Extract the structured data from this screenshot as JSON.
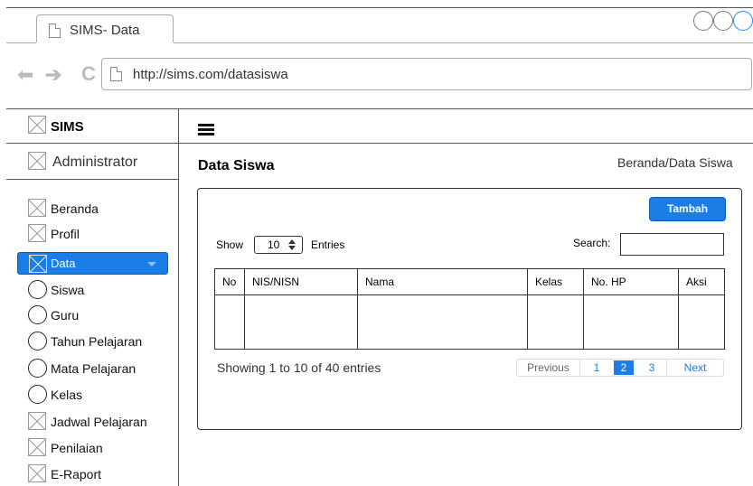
{
  "browser": {
    "tab_title": "SIMS- Data",
    "url": "http://sims.com/datasiswa",
    "back_glyph": "⬅",
    "forward_glyph": "➔",
    "reload_glyph": "C"
  },
  "sidebar": {
    "brand": "SIMS",
    "user": "Administrator",
    "items": [
      {
        "label": "Beranda",
        "icon": "image-placeholder-icon"
      },
      {
        "label": "Profil",
        "icon": "image-placeholder-icon"
      },
      {
        "label": "Data",
        "icon": "image-placeholder-icon",
        "active": true
      },
      {
        "label": "Siswa",
        "icon": "circle-icon"
      },
      {
        "label": "Guru",
        "icon": "circle-icon"
      },
      {
        "label": "Tahun Pelajaran",
        "icon": "circle-icon"
      },
      {
        "label": "Mata Pelajaran",
        "icon": "circle-icon"
      },
      {
        "label": "Kelas",
        "icon": "circle-icon"
      },
      {
        "label": "Jadwal Pelajaran",
        "icon": "image-placeholder-icon"
      },
      {
        "label": "Penilaian",
        "icon": "image-placeholder-icon"
      },
      {
        "label": "E-Raport",
        "icon": "image-placeholder-icon"
      }
    ]
  },
  "main": {
    "title": "Data Siswa",
    "breadcrumb": "Beranda/Data Siswa",
    "add_button": "Tambah",
    "show_label": "Show",
    "entries_value": "10",
    "entries_label": "Entries",
    "search_label": "Search:",
    "search_value": "",
    "table": {
      "columns": [
        "No",
        "NIS/NISN",
        "Nama",
        "Kelas",
        "No. HP",
        "Aksi"
      ]
    },
    "info": "Showing 1 to 10 of 40 entries",
    "pagination": {
      "previous": "Previous",
      "pages": [
        "1",
        "2",
        "3"
      ],
      "current": "2",
      "next": "Next"
    }
  },
  "colors": {
    "accent": "#1a7ee6",
    "border": "#333333"
  }
}
